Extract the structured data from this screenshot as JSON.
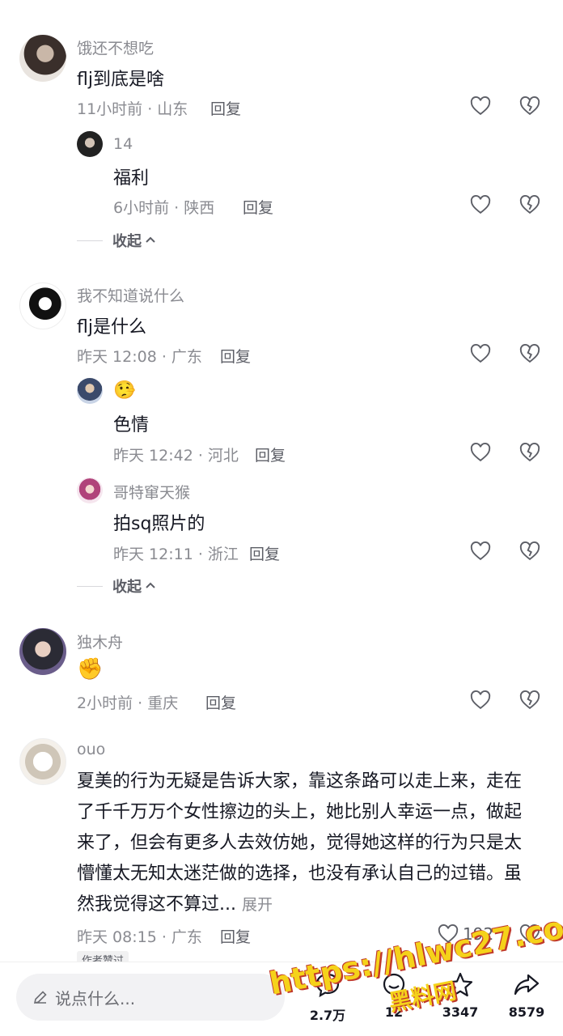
{
  "comments": [
    {
      "user": "饿还不想吃",
      "text": "flj到底是啥",
      "meta": "11小时前 · 山东",
      "reply_label": "回复",
      "replies": [
        {
          "user": "14",
          "text": "福利",
          "meta": "6小时前 · 陕西",
          "reply_label": "回复"
        }
      ],
      "collapse_label": "收起"
    },
    {
      "user": "我不知道说什么",
      "text": "flj是什么",
      "meta": "昨天 12:08 · 广东",
      "reply_label": "回复",
      "replies": [
        {
          "user": "🤥",
          "text": "色情",
          "meta": "昨天 12:42 · 河北",
          "reply_label": "回复"
        },
        {
          "user": "哥特窜天猴",
          "text": "拍sq照片的",
          "meta": "昨天 12:11 · 浙江",
          "reply_label": "回复"
        }
      ],
      "collapse_label": "收起"
    },
    {
      "user": "独木舟",
      "text": "✊",
      "meta": "2小时前 · 重庆",
      "reply_label": "回复"
    },
    {
      "user": "ouo",
      "text": "夏美的行为无疑是告诉大家，靠这条路可以走上来，走在了千千万万个女性擦边的头上，她比别人幸运一点，做起来了，但会有更多人去效仿她，觉得她这样的行为只是太懵懂太无知太迷茫做的选择，也没有承认自己的过错。虽然我觉得这不算过...",
      "expand_label": "展开",
      "meta": "昨天 08:15 · 广东",
      "reply_label": "回复",
      "like_count": "192",
      "author_tag": "作者赞过"
    }
  ],
  "bottom_bar": {
    "input_placeholder": "说点什么...",
    "actions": [
      {
        "icon": "comment-icon",
        "count": "2.7万"
      },
      {
        "icon": "chat-icon",
        "count": "12"
      },
      {
        "icon": "star-icon",
        "count": "3347"
      },
      {
        "icon": "share-icon",
        "count": "8579"
      }
    ]
  },
  "watermark": {
    "line1": "https://hlwc27.com",
    "line2": "黑料网"
  },
  "colors": {
    "text": "#161823",
    "meta": "#8a8b91",
    "watermark": "#f5d21a"
  }
}
